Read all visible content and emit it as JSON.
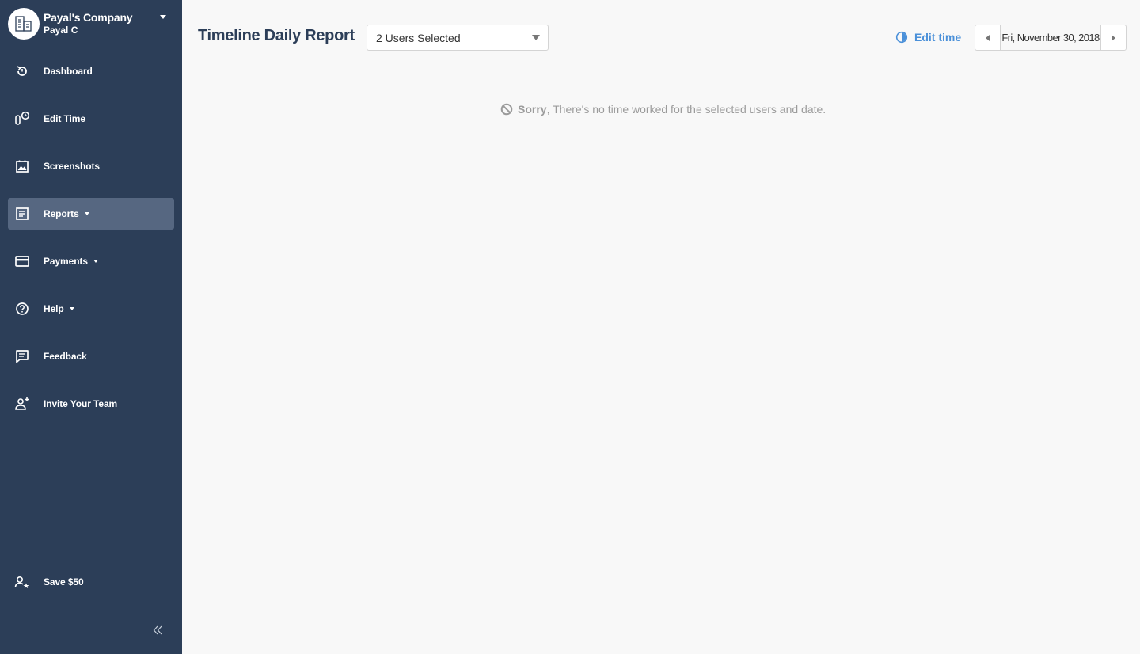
{
  "sidebar": {
    "company_name": "Payal's Company",
    "user_name": "Payal C",
    "items": [
      {
        "label": "Dashboard",
        "icon": "dashboard-icon"
      },
      {
        "label": "Edit Time",
        "icon": "edit-time-icon"
      },
      {
        "label": "Screenshots",
        "icon": "screenshots-icon"
      },
      {
        "label": "Reports",
        "icon": "reports-icon",
        "active": true,
        "has_caret": true
      },
      {
        "label": "Payments",
        "icon": "payments-icon",
        "has_caret": true
      },
      {
        "label": "Help",
        "icon": "help-icon",
        "has_caret": true
      },
      {
        "label": "Feedback",
        "icon": "feedback-icon"
      },
      {
        "label": "Invite Your Team",
        "icon": "invite-team-icon"
      }
    ],
    "save_label": "Save $50",
    "collapse_icon": "double-chevron-left-icon"
  },
  "header": {
    "title": "Timeline Daily Report",
    "user_select_value": "2 Users Selected",
    "edit_time_label": "Edit time",
    "date": "Fri, November 30, 2018"
  },
  "empty_state": {
    "strong": "Sorry",
    "message": ", There's no time worked for the selected users and date."
  },
  "colors": {
    "sidebar_bg": "#2c3e58",
    "sidebar_active": "#566781",
    "accent": "#4a90d9",
    "title": "#2c3e58",
    "page_bg": "#f8f8f8"
  }
}
